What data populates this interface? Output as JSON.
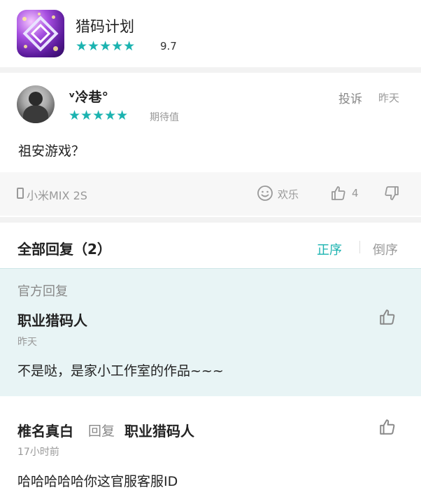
{
  "app": {
    "name": "猎码计划",
    "stars": "★★★★★",
    "rating": "9.7",
    "icon": "app-logo-diamond",
    "accent_color": "#1bb3b0"
  },
  "review": {
    "author": "ᵛ冷巷°",
    "stars": "★★★★★",
    "rating_label": "期待值",
    "report": "投诉",
    "date": "昨天",
    "text": "祖安游戏？",
    "device": "小米MIX 2S",
    "mood": "欢乐",
    "likes": "4"
  },
  "replies": {
    "title": "全部回复（2）",
    "sort_asc": "正序",
    "sort_desc": "倒序",
    "items": [
      {
        "badge": "官方回复",
        "author": "职业猎码人",
        "date": "昨天",
        "text": "不是哒，是家小工作室的作品~~~",
        "background": "#e8f4f5"
      },
      {
        "author": "椎名真白",
        "reply_verb": "回复",
        "target": "职业猎码人",
        "date": "17小时前",
        "text": "哈哈哈哈哈你这官服客服ID"
      }
    ]
  }
}
